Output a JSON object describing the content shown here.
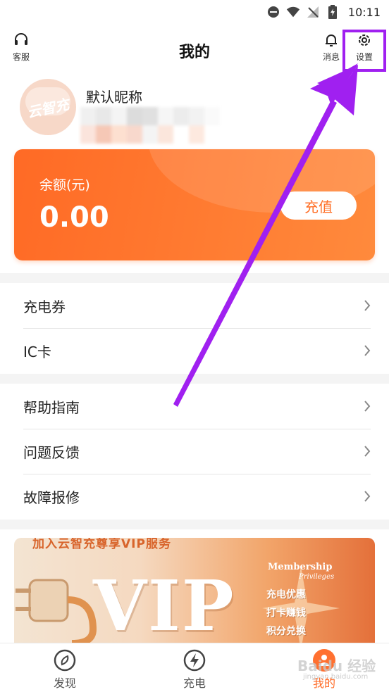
{
  "status_bar": {
    "time": "10:11",
    "icons": [
      "dnd-icon",
      "wifi-icon",
      "no-signal-icon",
      "battery-icon"
    ]
  },
  "header": {
    "title": "我的",
    "service_label": "客服",
    "message_label": "消息",
    "settings_label": "设置"
  },
  "user": {
    "avatar_text": "云智充",
    "nickname": "默认昵称"
  },
  "balance": {
    "label": "余额(元)",
    "value": "0.00",
    "recharge_label": "充值"
  },
  "menu_group_1": [
    {
      "label": "充电券"
    },
    {
      "label": "IC卡"
    }
  ],
  "menu_group_2": [
    {
      "label": "帮助指南"
    },
    {
      "label": "问题反馈"
    },
    {
      "label": "故障报修"
    }
  ],
  "vip_banner": {
    "top_text": "加入云智充尊享VIP服务",
    "big_text": "VIP",
    "membership": "Membership",
    "privileges": "Privileges",
    "features": [
      "充电优惠",
      "打卡赚钱",
      "积分兑换"
    ]
  },
  "tabbar": {
    "discover": "发现",
    "charge": "充电",
    "mine": "我的"
  },
  "watermark": {
    "main": "Baidu 经验",
    "sub": "jingyan.baidu.com"
  },
  "colors": {
    "accent": "#ff6a25",
    "annotation": "#a020f0"
  }
}
